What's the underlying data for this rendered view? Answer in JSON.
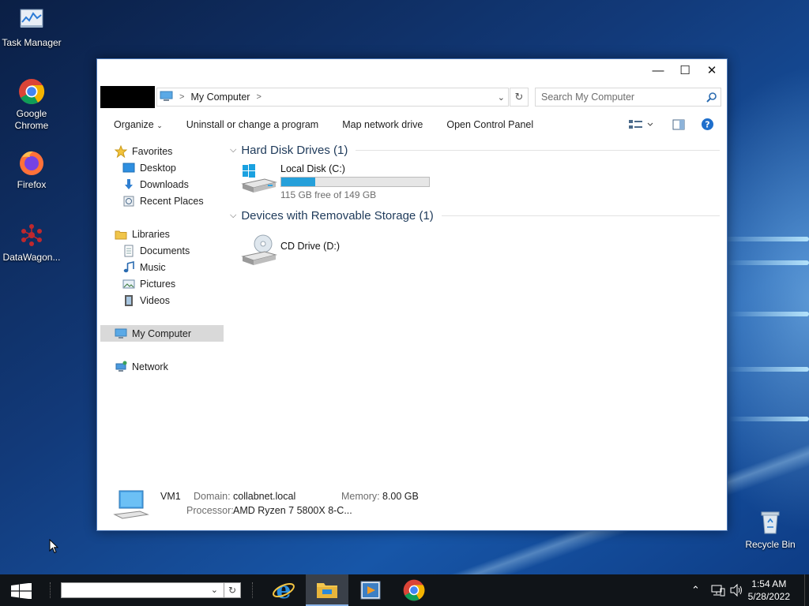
{
  "desktop": {
    "icons": [
      {
        "label": "Task Manager"
      },
      {
        "label": "Google Chrome"
      },
      {
        "label": "Firefox"
      },
      {
        "label": "DataWagon..."
      },
      {
        "label": "Recycle Bin"
      }
    ]
  },
  "window": {
    "controls": {
      "minimize": "—",
      "maximize": "☐",
      "close": "✕"
    },
    "address": {
      "root_sep": ">",
      "location": "My Computer",
      "trail_sep": ">"
    },
    "search": {
      "placeholder": "Search My Computer"
    },
    "toolbar": {
      "organize": "Organize",
      "uninstall": "Uninstall or change a program",
      "map_drive": "Map network drive",
      "control_panel": "Open Control Panel"
    },
    "nav": {
      "favorites": "Favorites",
      "desktop": "Desktop",
      "downloads": "Downloads",
      "recent": "Recent Places",
      "libraries": "Libraries",
      "documents": "Documents",
      "music": "Music",
      "pictures": "Pictures",
      "videos": "Videos",
      "my_computer": "My Computer",
      "network": "Network"
    },
    "groups": {
      "hdd": "Hard Disk Drives (1)",
      "removable": "Devices with Removable Storage (1)"
    },
    "drives": {
      "c": {
        "name": "Local Disk (C:)",
        "free": "115 GB free of 149 GB",
        "used_fraction": 0.23
      },
      "d": {
        "name": "CD Drive (D:)"
      }
    },
    "details": {
      "computer_name": "VM1",
      "domain_label": "Domain:",
      "domain_value": "collabnet.local",
      "memory_label": "Memory:",
      "memory_value": "8.00 GB",
      "processor_label": "Processor:",
      "processor_value": "AMD Ryzen 7 5800X 8-C..."
    }
  },
  "taskbar": {
    "clock_time": "1:54 AM",
    "clock_date": "5/28/2022"
  }
}
